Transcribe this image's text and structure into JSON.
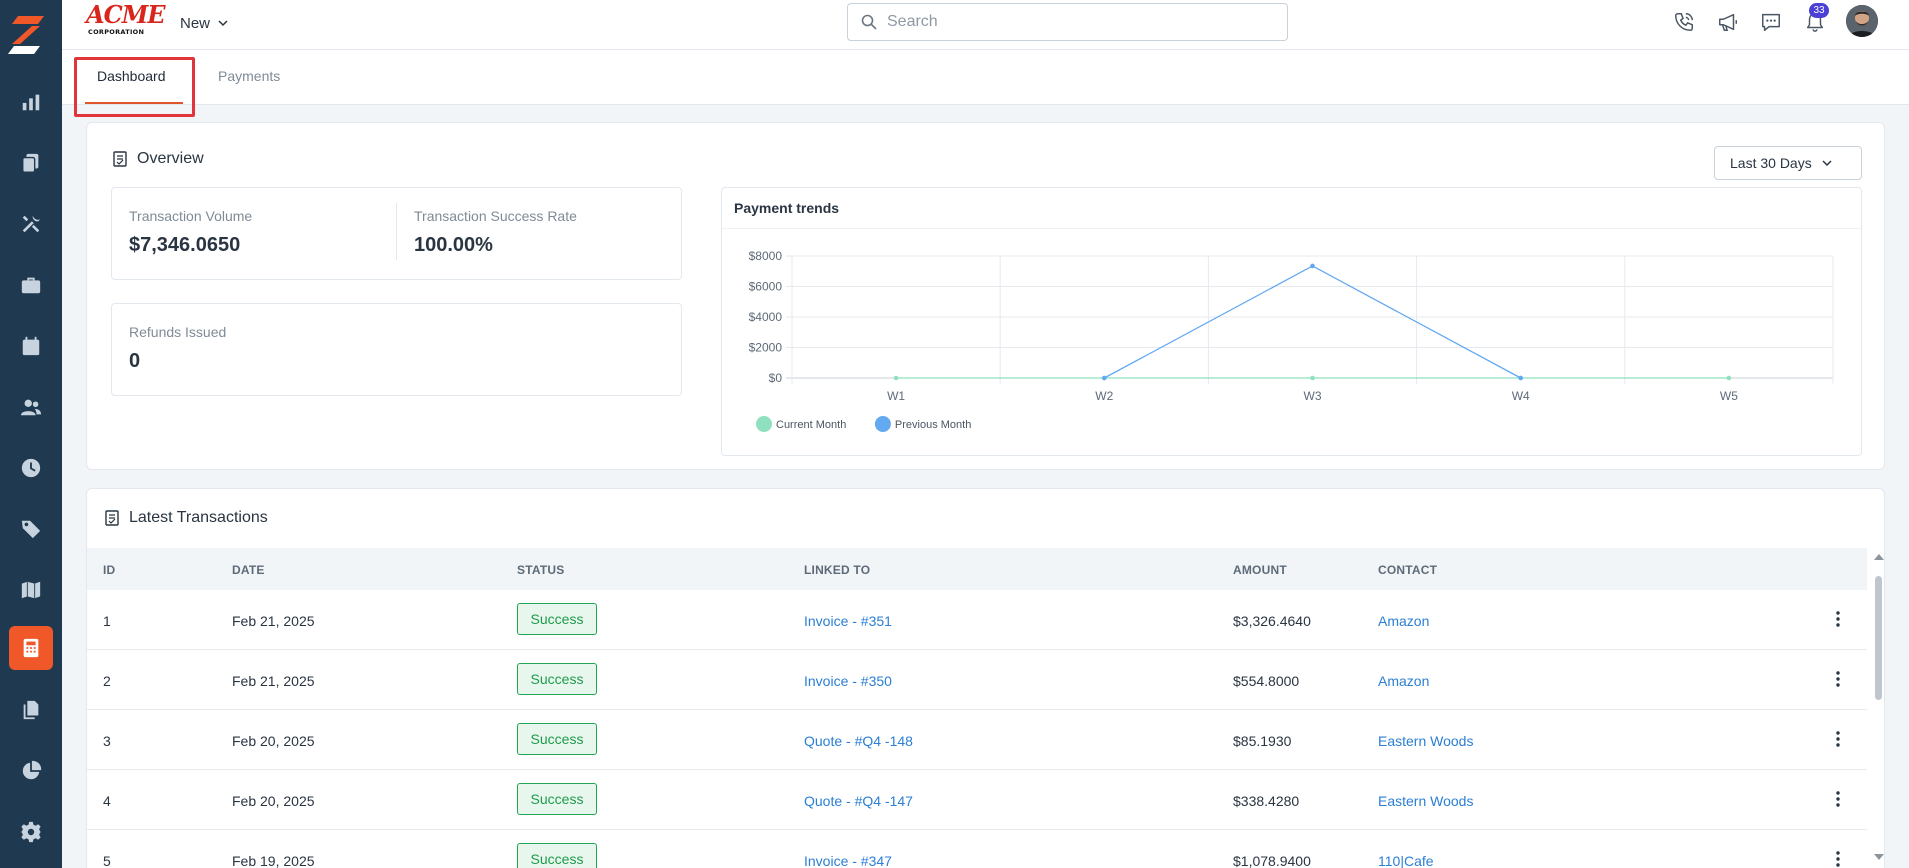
{
  "header": {
    "brand_word": "ACME",
    "brand_sub": "CORPORATION",
    "new_label": "New",
    "search_placeholder": "Search",
    "notification_count": "33",
    "icons": [
      "phone-icon",
      "megaphone-icon",
      "chat-icon",
      "bell-icon"
    ]
  },
  "sidebar": {
    "items": [
      {
        "name": "reports",
        "icon": "bar-chart-icon"
      },
      {
        "name": "documents",
        "icon": "copy-icon"
      },
      {
        "name": "tools",
        "icon": "tools-icon"
      },
      {
        "name": "jobs",
        "icon": "briefcase-icon"
      },
      {
        "name": "calendar",
        "icon": "calendar-icon"
      },
      {
        "name": "people",
        "icon": "users-icon"
      },
      {
        "name": "time",
        "icon": "clock-icon"
      },
      {
        "name": "tags",
        "icon": "tag-icon"
      },
      {
        "name": "map",
        "icon": "map-icon"
      },
      {
        "name": "payments",
        "icon": "calculator-icon",
        "active": true
      },
      {
        "name": "files",
        "icon": "files-icon"
      },
      {
        "name": "analytics",
        "icon": "pie-chart-icon"
      },
      {
        "name": "settings",
        "icon": "gear-icon"
      }
    ]
  },
  "tabs": {
    "dashboard": "Dashboard",
    "payments": "Payments",
    "active": "Dashboard"
  },
  "overview": {
    "title": "Overview",
    "range": "Last 30 Days",
    "stats": {
      "volume_label": "Transaction Volume",
      "volume_value": "$7,346.0650",
      "success_label": "Transaction Success Rate",
      "success_value": "100.00%",
      "refunds_label": "Refunds Issued",
      "refunds_value": "0"
    }
  },
  "chart_data": {
    "type": "line",
    "title": "Payment trends",
    "categories": [
      "W1",
      "W2",
      "W3",
      "W4",
      "W5"
    ],
    "series": [
      {
        "name": "Current Month",
        "color": "#8ee0be",
        "values": [
          0,
          0,
          0,
          0,
          0
        ]
      },
      {
        "name": "Previous Month",
        "color": "#63a9f2",
        "values": [
          null,
          0,
          7346,
          0,
          null
        ]
      }
    ],
    "y_ticks": [
      "$0",
      "$2000",
      "$4000",
      "$6000",
      "$8000"
    ],
    "ylim": [
      0,
      8000
    ],
    "legend": "bottom-left",
    "grid": true
  },
  "transactions": {
    "title": "Latest Transactions",
    "columns": {
      "id": "ID",
      "date": "DATE",
      "status": "STATUS",
      "linked": "LINKED TO",
      "amount": "AMOUNT",
      "contact": "CONTACT"
    },
    "rows": [
      {
        "id": "1",
        "date": "Feb 21, 2025",
        "status": "Success",
        "linked": "Invoice - #351",
        "amount": "$3,326.4640",
        "contact": "Amazon"
      },
      {
        "id": "2",
        "date": "Feb 21, 2025",
        "status": "Success",
        "linked": "Invoice - #350",
        "amount": "$554.8000",
        "contact": "Amazon"
      },
      {
        "id": "3",
        "date": "Feb 20, 2025",
        "status": "Success",
        "linked": "Quote - #Q4 -148",
        "amount": "$85.1930",
        "contact": "Eastern Woods"
      },
      {
        "id": "4",
        "date": "Feb 20, 2025",
        "status": "Success",
        "linked": "Quote - #Q4 -147",
        "amount": "$338.4280",
        "contact": "Eastern Woods"
      },
      {
        "id": "5",
        "date": "Feb 19, 2025",
        "status": "Success",
        "linked": "Invoice - #347",
        "amount": "$1,078.9400",
        "contact": "110|Cafe"
      }
    ]
  }
}
